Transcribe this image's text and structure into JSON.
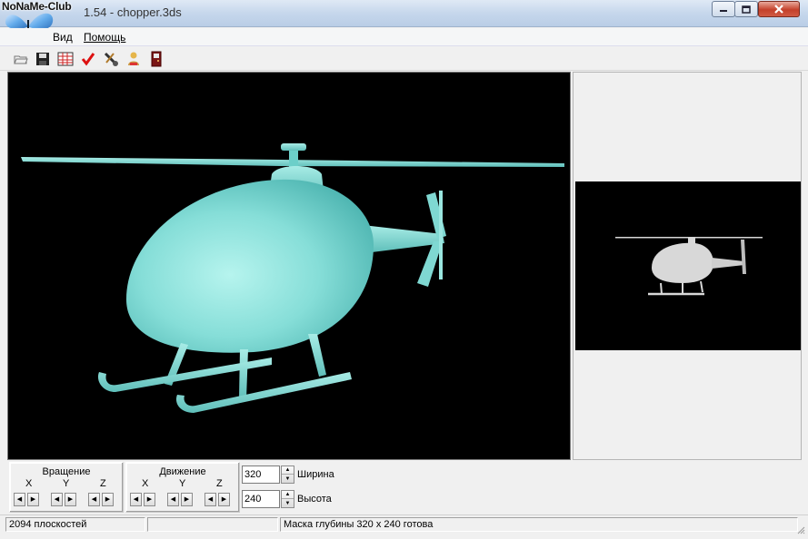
{
  "window": {
    "logo_text": "NoNaMe-Club",
    "title": "1.54 - chopper.3ds"
  },
  "menu": {
    "items": [
      {
        "label": "Вид"
      },
      {
        "label": "Помощь"
      }
    ]
  },
  "toolbar": {
    "icons": [
      "open-icon",
      "save-icon",
      "grid-icon",
      "checkmark-icon",
      "settings-icon",
      "users-icon",
      "exit-icon"
    ]
  },
  "controls": {
    "rotation": {
      "title": "Вращение",
      "axes": [
        "X",
        "Y",
        "Z"
      ]
    },
    "movement": {
      "title": "Движение",
      "axes": [
        "X",
        "Y",
        "Z"
      ]
    },
    "width": {
      "value": "320",
      "label": "Ширина"
    },
    "height": {
      "value": "240",
      "label": "Высота"
    }
  },
  "status": {
    "faces": "2094 плоскостей",
    "middle": "",
    "message": "Маска глубины 320 x 240 готова"
  },
  "colors": {
    "model": "#86ded8",
    "viewport_bg": "#000000",
    "depth_model": "#d8d8d8"
  }
}
